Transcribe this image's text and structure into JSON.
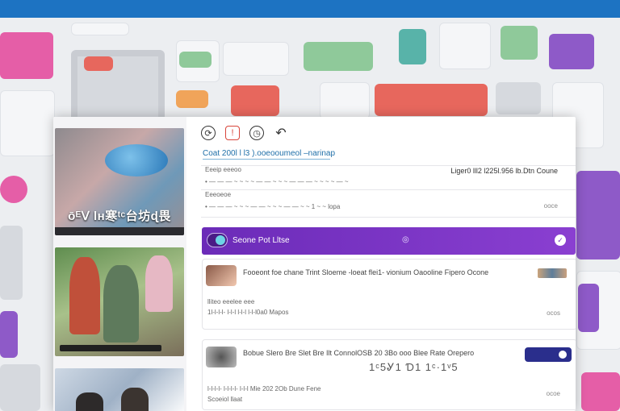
{
  "toolbar": {
    "icons": [
      "refresh-icon",
      "alert-icon",
      "clock-icon",
      "undo-icon"
    ]
  },
  "content": {
    "subtitle": "Coat  200l  l l3 ).ooeooumeol  –narinap"
  },
  "rows": [
    {
      "label": "Eeeip eeeoo",
      "right": "Liger0 lll2  l225l.956 lb.Dtn Coune"
    },
    {
      "label": "• — — — ~ ~ ~ ~ — — ~ ~ ~ — — — ~ ~ ~ ~ — ~",
      "mini": ""
    },
    {
      "label": "Eeeoeoe",
      "mini": ""
    },
    {
      "label": "• — — — ~ ~ ~ — — ~ ~ ~ — — ~ ~ 1 ~ ~ lopa",
      "mini": "ooce"
    }
  ],
  "banner": {
    "label": "Seone Pot Lltse"
  },
  "cards": [
    {
      "message": "Fooeont  foe chane  Trint  Sloeme  -loeat  flei1-  vionium  Oaooline  Fipero  Ocone",
      "meta1": "lliteo  eeelee  eee",
      "meta2": "1l-l-l-l-  l-l-l  l-l-l  l-l-l0a0  Mapos",
      "mini": "ocos"
    },
    {
      "message": "Bobue  Slero  Bre  Slet  Bre  Ilt  ConnolOSB  20  3Bo  ooo  Blee  Rate  Orepero",
      "big": "1ᶜ5Ꮍ1  Ɗ1 1ᶜ·1ᵛ5",
      "meta1": "l-l-l-l-  l-l-l-l-  l-l-l  Mie  202  2Ob  Dune  Fene",
      "meta2": "Scoeiol llaat",
      "mini": "ocoe"
    }
  ],
  "gallery": {
    "caption": "ōᴱⅤ lʜ寒ᵗᶜ台坊ɖ畏",
    "strip_text": "▪ ▪ ▪ ▪ ▪"
  }
}
